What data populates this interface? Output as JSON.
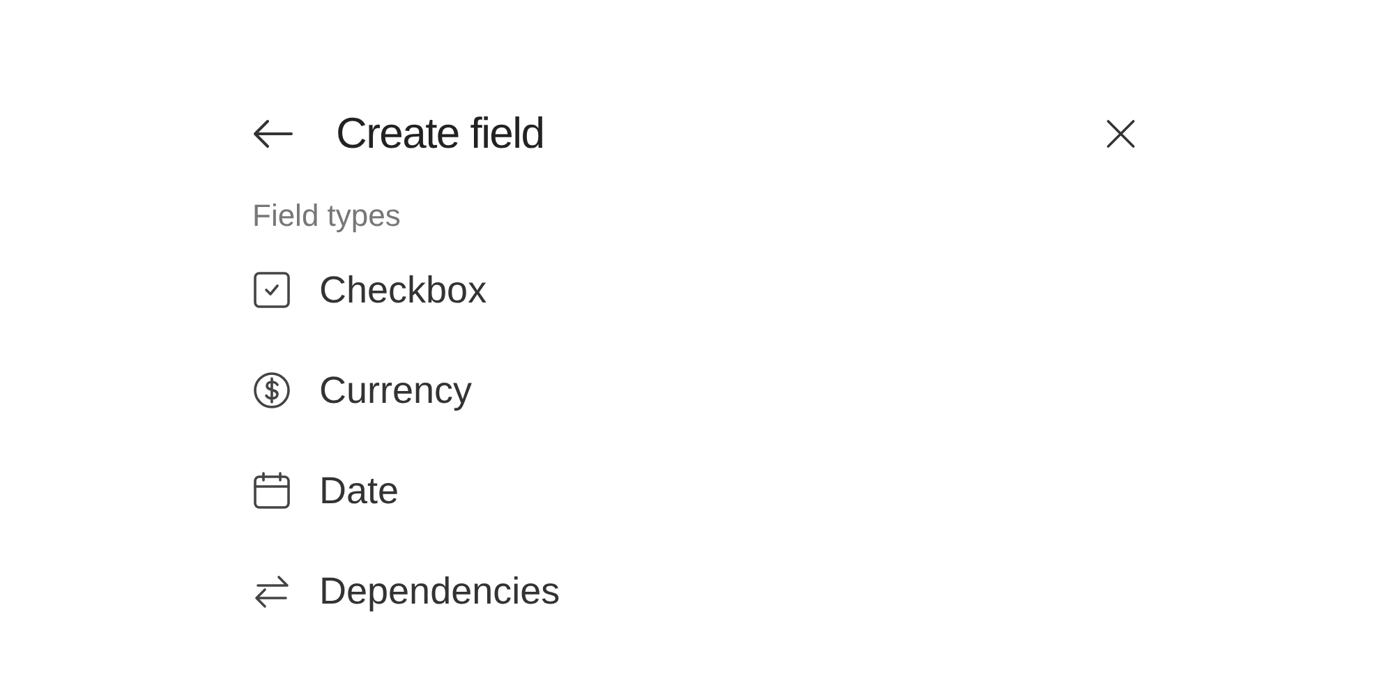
{
  "header": {
    "title": "Create field"
  },
  "section": {
    "label": "Field types"
  },
  "field_types": [
    {
      "kind": "checkbox",
      "label": "Checkbox"
    },
    {
      "kind": "currency",
      "label": "Currency"
    },
    {
      "kind": "date",
      "label": "Date"
    },
    {
      "kind": "dependencies",
      "label": "Dependencies"
    }
  ]
}
